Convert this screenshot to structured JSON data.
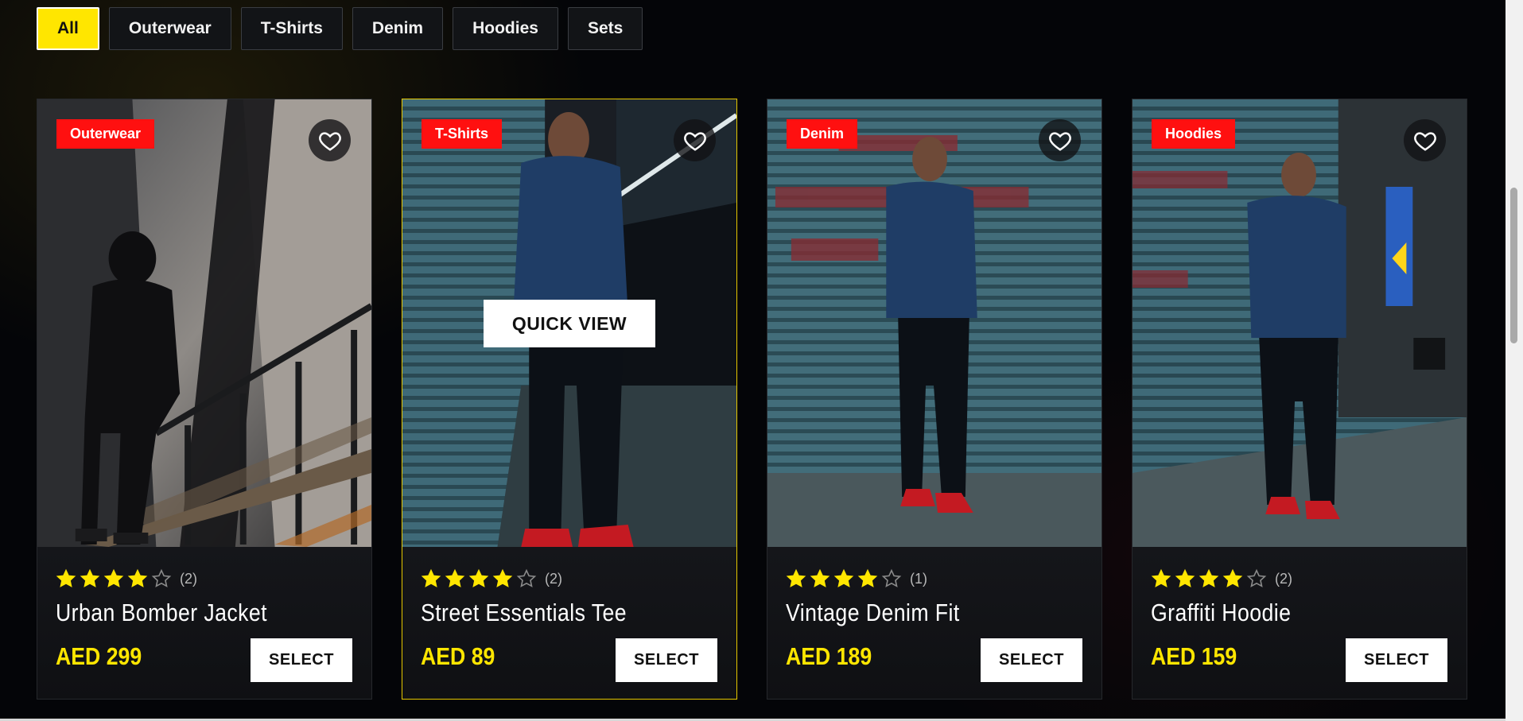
{
  "filters": [
    {
      "label": "All",
      "active": true
    },
    {
      "label": "Outerwear",
      "active": false
    },
    {
      "label": "T-Shirts",
      "active": false
    },
    {
      "label": "Denim",
      "active": false
    },
    {
      "label": "Hoodies",
      "active": false
    },
    {
      "label": "Sets",
      "active": false
    }
  ],
  "products": [
    {
      "badge": "Outerwear",
      "name": "Urban Bomber Jacket",
      "price": "AED 299",
      "rating": 4,
      "rating_max": 5,
      "review_count": "(2)",
      "select_label": "SELECT",
      "icon": "heart-icon"
    },
    {
      "badge": "T-Shirts",
      "name": "Street Essentials Tee",
      "price": "AED 89",
      "rating": 4,
      "rating_max": 5,
      "review_count": "(2)",
      "select_label": "SELECT",
      "quick_view_label": "QUICK VIEW",
      "icon": "heart-icon"
    },
    {
      "badge": "Denim",
      "name": "Vintage Denim Fit",
      "price": "AED 189",
      "rating": 4,
      "rating_max": 5,
      "review_count": "(1)",
      "select_label": "SELECT",
      "icon": "heart-icon"
    },
    {
      "badge": "Hoodies",
      "name": "Graffiti Hoodie",
      "price": "AED 159",
      "rating": 4,
      "rating_max": 5,
      "review_count": "(2)",
      "select_label": "SELECT",
      "icon": "heart-icon"
    }
  ],
  "colors": {
    "accent": "#ffe600",
    "badge": "#ff1010",
    "background": "#040508"
  }
}
